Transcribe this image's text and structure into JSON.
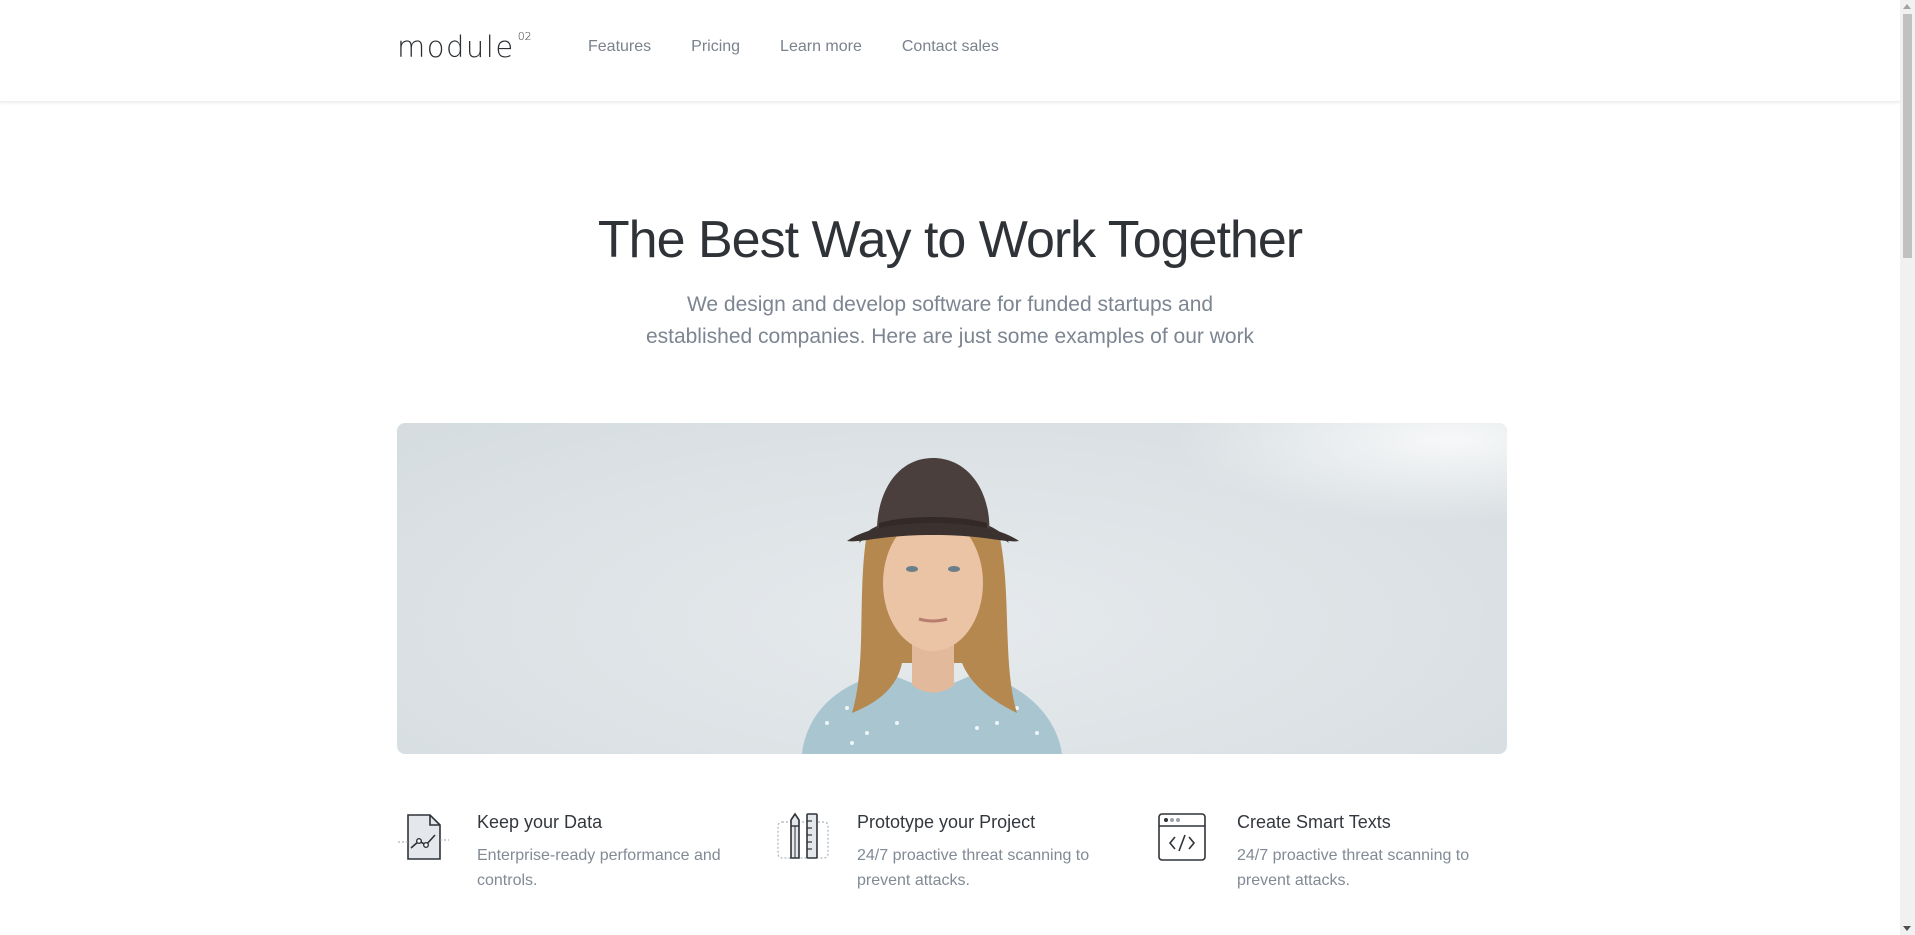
{
  "header": {
    "logo_text": "module",
    "logo_sup": "02",
    "nav": [
      {
        "label": "Features"
      },
      {
        "label": "Pricing"
      },
      {
        "label": "Learn more"
      },
      {
        "label": "Contact sales"
      }
    ]
  },
  "hero": {
    "title": "The Best Way to Work Together",
    "subtitle_line1": "We design and develop software for funded startups and",
    "subtitle_line2": "established companies. Here are just some examples of our work"
  },
  "features": [
    {
      "icon": "chart-document-icon",
      "title": "Keep your Data",
      "description": "Enterprise-ready performance and controls."
    },
    {
      "icon": "pencil-ruler-icon",
      "title": "Prototype your Project",
      "description": "24/7 proactive threat scanning to prevent attacks."
    },
    {
      "icon": "code-window-icon",
      "title": "Create Smart Texts",
      "description": "24/7 proactive threat scanning to prevent attacks."
    }
  ],
  "colors": {
    "nav_text": "#7a828c",
    "heading": "#2f3338",
    "muted": "#7c8591",
    "image_bg": "#dce2e5"
  }
}
